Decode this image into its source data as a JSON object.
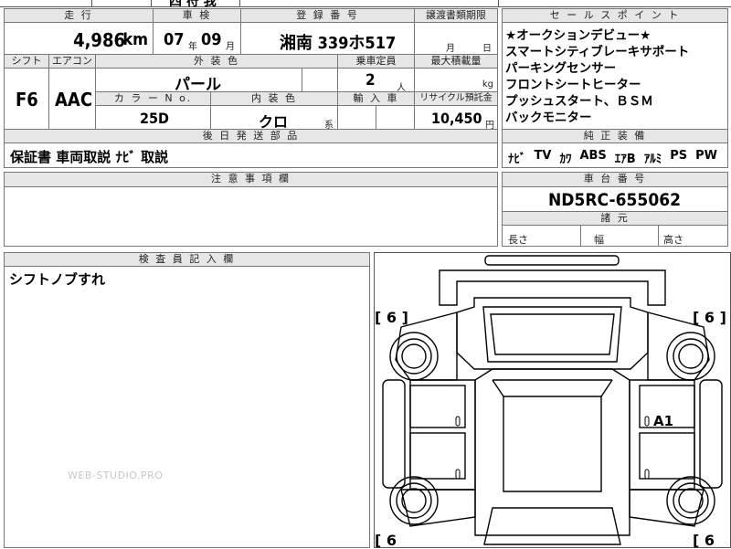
{
  "top_strip": {
    "partial_text": "四 符 我"
  },
  "row1": {
    "mileage_header": "走 行",
    "mileage_value": "4,986",
    "mileage_unit": "km",
    "shaken_header": "車 検",
    "shaken_year": "07",
    "shaken_year_unit": "年",
    "shaken_month": "09",
    "shaken_month_unit": "月",
    "reg_header": "登 録 番 号",
    "reg_value": "湘南 339ホ517",
    "transfer_header": "譲渡書類期限",
    "transfer_month_unit": "月",
    "transfer_day_unit": "日"
  },
  "row2": {
    "shift_header": "シフト",
    "aircon_header": "エアコン",
    "exterior_header": "外 装 色",
    "capacity_header": "乗車定員",
    "maxload_header": "最大積載量",
    "shift_value": "F6",
    "aircon_value": "AAC",
    "exterior_value": "パール",
    "capacity_value": "2",
    "capacity_unit": "人",
    "maxload_unit": "kg",
    "colorno_header": "カ ラ ー N o.",
    "interior_header": "内 装 色",
    "import_header": "輸 入 車",
    "recycle_header": "リサイクル預託金",
    "colorno_value": "25D",
    "interior_value": "クロ",
    "interior_suffix": "系",
    "recycle_value": "10,450",
    "recycle_unit": "円"
  },
  "later_parts": {
    "header": "後 日 発 送 部 品",
    "value": "保証書 車両取説 ﾅﾋﾞ 取説"
  },
  "notes": {
    "header": "注 意 事 項 欄",
    "value": ""
  },
  "sales_points": {
    "header": "セ ー ル ス ポ イ ン ト",
    "lines": [
      "★オークションデビュー★",
      "スマートシティブレーキサポート",
      "パーキングセンサー",
      "フロントシートヒーター",
      "プッシュスタート、ＢＳＭ",
      "バックモニター"
    ]
  },
  "equipment": {
    "header": "純 正 装 備",
    "items": [
      "ﾅﾋﾞ",
      "TV",
      "ｶﾜ",
      "ABS",
      "ｴｱB",
      "ｱﾙﾐ",
      "PS",
      "PW"
    ]
  },
  "chassis": {
    "header": "車 台 番 号",
    "value": "ND5RC-655062"
  },
  "dimensions": {
    "header": "諸 元",
    "length_label": "長さ",
    "width_label": "幅",
    "height_label": "高さ"
  },
  "inspector": {
    "header": "検 査 員 記 入 欄",
    "value": "シフトノブすれ"
  },
  "diagram": {
    "tire_front_left": "[ 6 ]",
    "tire_front_right": "[ 6 ]",
    "tire_rear_left": "[ 6",
    "tire_rear_right": "[ 6",
    "damage_mark": "A1"
  },
  "watermark": "WEB-STUDIO.PRO"
}
